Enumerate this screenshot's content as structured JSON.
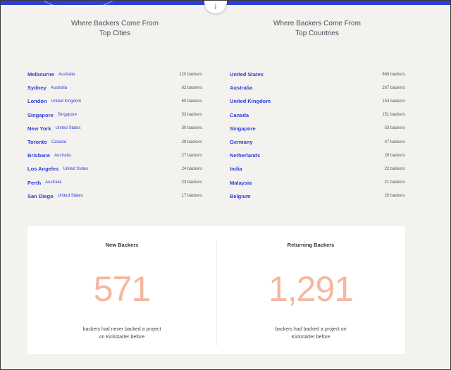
{
  "colors": {
    "accent": "#2d3fd6",
    "stat_number": "#f5b7a0",
    "background": "#f4f2ef"
  },
  "scroll_button": {
    "icon": "arrow-down-icon",
    "glyph": "↓"
  },
  "cities": {
    "heading_line1": "Where Backers Come From",
    "heading_line2": "Top Cities",
    "items": [
      {
        "name": "Melbourne",
        "country": "Australia",
        "count": "120 backers"
      },
      {
        "name": "Sydney",
        "country": "Australia",
        "count": "62 backers"
      },
      {
        "name": "London",
        "country": "United Kingdom",
        "count": "60 backers"
      },
      {
        "name": "Singapore",
        "country": "Singapore",
        "count": "53 backers"
      },
      {
        "name": "New York",
        "country": "United States",
        "count": "30 backers"
      },
      {
        "name": "Toronto",
        "country": "Canada",
        "count": "29 backers"
      },
      {
        "name": "Brisbane",
        "country": "Australia",
        "count": "27 backers"
      },
      {
        "name": "Los Angeles",
        "country": "United States",
        "count": "24 backers"
      },
      {
        "name": "Perth",
        "country": "Australia",
        "count": "23 backers"
      },
      {
        "name": "San Diego",
        "country": "United States",
        "count": "17 backers"
      }
    ]
  },
  "countries": {
    "heading_line1": "Where Backers Come From",
    "heading_line2": "Top Countries",
    "items": [
      {
        "name": "United States",
        "count": "666 backers"
      },
      {
        "name": "Australia",
        "count": "267 backers"
      },
      {
        "name": "United Kingdom",
        "count": "153 backers"
      },
      {
        "name": "Canada",
        "count": "151 backers"
      },
      {
        "name": "Singapore",
        "count": "53 backers"
      },
      {
        "name": "Germany",
        "count": "47 backers"
      },
      {
        "name": "Netherlands",
        "count": "28 backers"
      },
      {
        "name": "India",
        "count": "22 backers"
      },
      {
        "name": "Malaysia",
        "count": "21 backers"
      },
      {
        "name": "Belgium",
        "count": "20 backers"
      }
    ]
  },
  "new_backers": {
    "title": "New Backers",
    "number": "571",
    "desc_line1": "backers had never backed a project",
    "desc_line2": "on Kickstarter before"
  },
  "returning_backers": {
    "title": "Returning Backers",
    "number": "1,291",
    "desc_line1": "backers had backed a project on",
    "desc_line2": "Kickstarter before"
  }
}
